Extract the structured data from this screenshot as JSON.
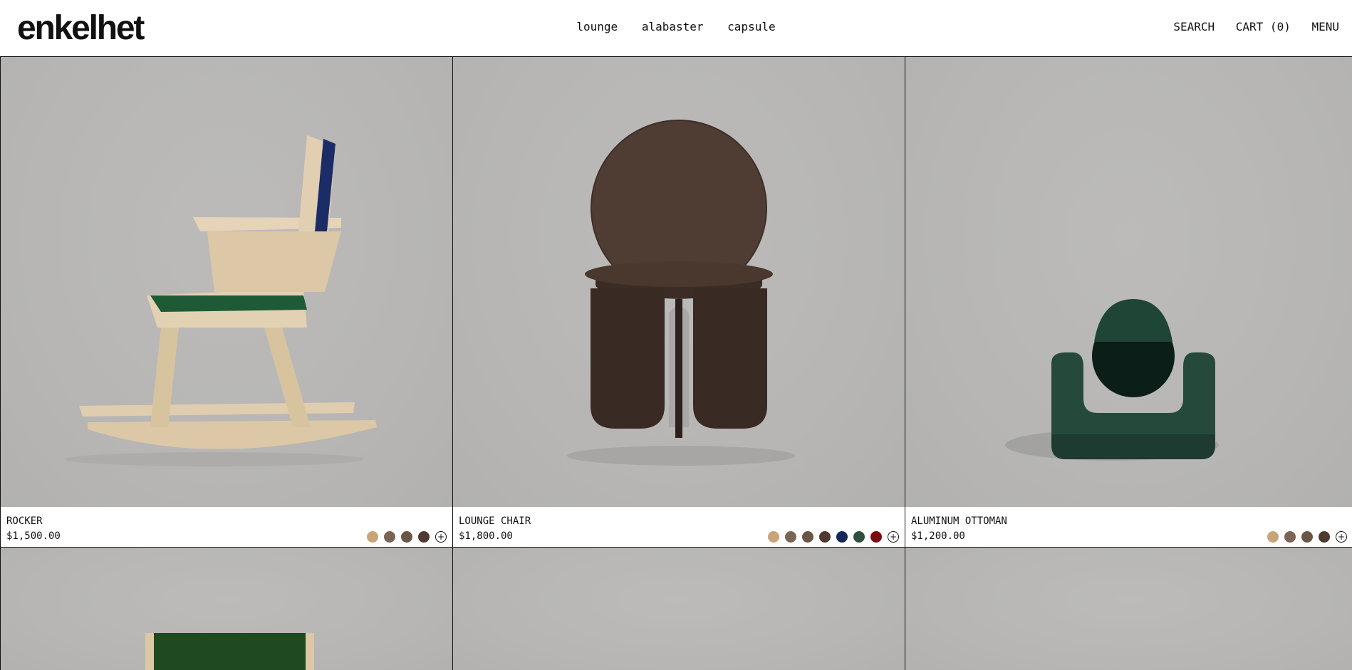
{
  "brand": {
    "logo": "enkelhet"
  },
  "nav": {
    "center": [
      "lounge",
      "alabaster",
      "capsule"
    ],
    "search": "SEARCH",
    "cart": "CART (0)",
    "menu": "MENU"
  },
  "products": [
    {
      "name": "ROCKER",
      "price": "$1,500.00",
      "image_icon": "rocking-chair-illustration",
      "swatches": [
        "#c9a477",
        "#7b6453",
        "#6a5646",
        "#4e3a2e"
      ]
    },
    {
      "name": "LOUNGE CHAIR",
      "price": "$1,800.00",
      "image_icon": "round-back-wood-chair-illustration",
      "swatches": [
        "#c9a477",
        "#7b6453",
        "#6a5646",
        "#4e3a2e",
        "#13275a",
        "#2f4f3f",
        "#7a0c10"
      ]
    },
    {
      "name": "ALUMINUM OTTOMAN",
      "price": "$1,200.00",
      "image_icon": "green-ottoman-illustration",
      "swatches": [
        "#c9a477",
        "#7b6453",
        "#6a5646",
        "#4e3a2e"
      ]
    }
  ],
  "colors": {
    "image_bg": "#b7b6b4",
    "border": "#111111"
  }
}
